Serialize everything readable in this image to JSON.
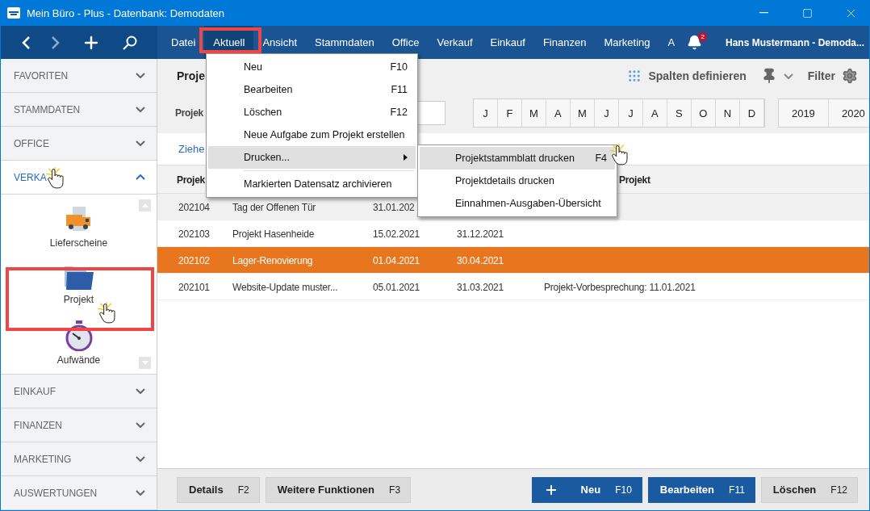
{
  "window": {
    "title": "Mein Büro - Plus - Datenbank: Demodaten"
  },
  "menu_bar": {
    "items": [
      {
        "label": "Datei",
        "selected": false
      },
      {
        "label": "Aktuell",
        "selected": true
      },
      {
        "label": "Ansicht",
        "selected": false
      },
      {
        "label": "Stammdaten",
        "selected": false
      },
      {
        "label": "Office",
        "selected": false
      },
      {
        "label": "Verkauf",
        "selected": false
      },
      {
        "label": "Einkauf",
        "selected": false
      },
      {
        "label": "Finanzen",
        "selected": false
      },
      {
        "label": "Marketing",
        "selected": false
      },
      {
        "label": "A",
        "selected": false
      }
    ],
    "notification_count": "2",
    "user": "Hans Mustermann - Demoda..."
  },
  "sidebar": {
    "sections": [
      {
        "label": "FAVORITEN",
        "expanded": false
      },
      {
        "label": "STAMMDATEN",
        "expanded": false
      },
      {
        "label": "OFFICE",
        "expanded": false
      },
      {
        "label": "VERKA",
        "expanded": true,
        "items": [
          {
            "label": "Lieferscheine",
            "kind": "truck",
            "selected": false
          },
          {
            "label": "Projekt",
            "kind": "folder",
            "selected": true
          },
          {
            "label": "Aufwände",
            "kind": "stopwatch",
            "selected": false
          }
        ]
      },
      {
        "label": "EINKAUF",
        "expanded": false
      },
      {
        "label": "FINANZEN",
        "expanded": false
      },
      {
        "label": "MARKETING",
        "expanded": false
      },
      {
        "label": "AUSWERTUNGEN",
        "expanded": false
      }
    ]
  },
  "page": {
    "title": "Proje",
    "columns_button": "Spalten definieren",
    "filter_button": "Filter",
    "filter_label": "Projek",
    "months": [
      {
        "label": "J",
        "selected": false
      },
      {
        "label": "F",
        "selected": false
      },
      {
        "label": "M",
        "selected": false
      },
      {
        "label": "A",
        "selected": false
      },
      {
        "label": "M",
        "selected": false
      },
      {
        "label": "J",
        "selected": false
      },
      {
        "label": "J",
        "selected": false
      },
      {
        "label": "A",
        "selected": false
      },
      {
        "label": "S",
        "selected": false
      },
      {
        "label": "O",
        "selected": false
      },
      {
        "label": "N",
        "selected": false
      },
      {
        "label": "D",
        "selected": false
      }
    ],
    "years": [
      {
        "label": "2019",
        "selected": false
      },
      {
        "label": "2020",
        "selected": false
      }
    ],
    "group_hint": "Ziehe"
  },
  "table": {
    "columns": [
      "Projek",
      "",
      "",
      "",
      "Projekt"
    ],
    "rows": [
      {
        "cells": [
          "202104",
          "Tag der Offenen Tür",
          "31.01.202"
        ],
        "selected": false,
        "hovered": true
      },
      {
        "cells": [
          "202103",
          "Projekt Hasenheide",
          "15.02.2021",
          "31.12.2021"
        ],
        "selected": false,
        "hovered": false
      },
      {
        "cells": [
          "202102",
          "Lager-Renovierung",
          "01.04.2021",
          "30.04.2021"
        ],
        "selected": true,
        "hovered": false
      },
      {
        "cells": [
          "202101",
          "Website-Update muster...",
          "05.01.2021",
          "31.03.2021",
          "Projekt-Vorbesprechung: 11.01.2021"
        ],
        "selected": false,
        "hovered": false
      }
    ]
  },
  "dropdown": {
    "items": [
      {
        "label": "Neu",
        "shortcut": "F10",
        "kind": "item",
        "highlighted": false
      },
      {
        "label": "Bearbeiten",
        "shortcut": "F11",
        "kind": "item",
        "highlighted": false
      },
      {
        "label": "Löschen",
        "shortcut": "F12",
        "kind": "item",
        "highlighted": false
      },
      {
        "label": "Neue Aufgabe zum Projekt erstellen",
        "kind": "item",
        "highlighted": false
      },
      {
        "label": "Drucken...",
        "kind": "submenu",
        "highlighted": true
      },
      {
        "kind": "separator"
      },
      {
        "label": "Markierten Datensatz archivieren",
        "kind": "item",
        "highlighted": false
      }
    ]
  },
  "submenu": {
    "items": [
      {
        "label": "Projektstammblatt drucken",
        "shortcut": "F4",
        "highlighted": true
      },
      {
        "label": "Projektdetails drucken",
        "highlighted": false
      },
      {
        "label": "Einnahmen-Ausgaben-Übersicht",
        "highlighted": false
      }
    ]
  },
  "bottom_bar": {
    "left": [
      {
        "label": "Details",
        "shortcut": "F2",
        "kind": "secondary"
      },
      {
        "label": "Weitere Funktionen",
        "shortcut": "F3",
        "kind": "secondary"
      }
    ],
    "right": [
      {
        "label": "Neu",
        "shortcut": "F10",
        "kind": "primary",
        "plus": true
      },
      {
        "label": "Bearbeiten",
        "shortcut": "F11",
        "kind": "primary",
        "plus": false
      },
      {
        "label": "Löschen",
        "shortcut": "F12",
        "kind": "secondary",
        "plus": false
      }
    ]
  }
}
